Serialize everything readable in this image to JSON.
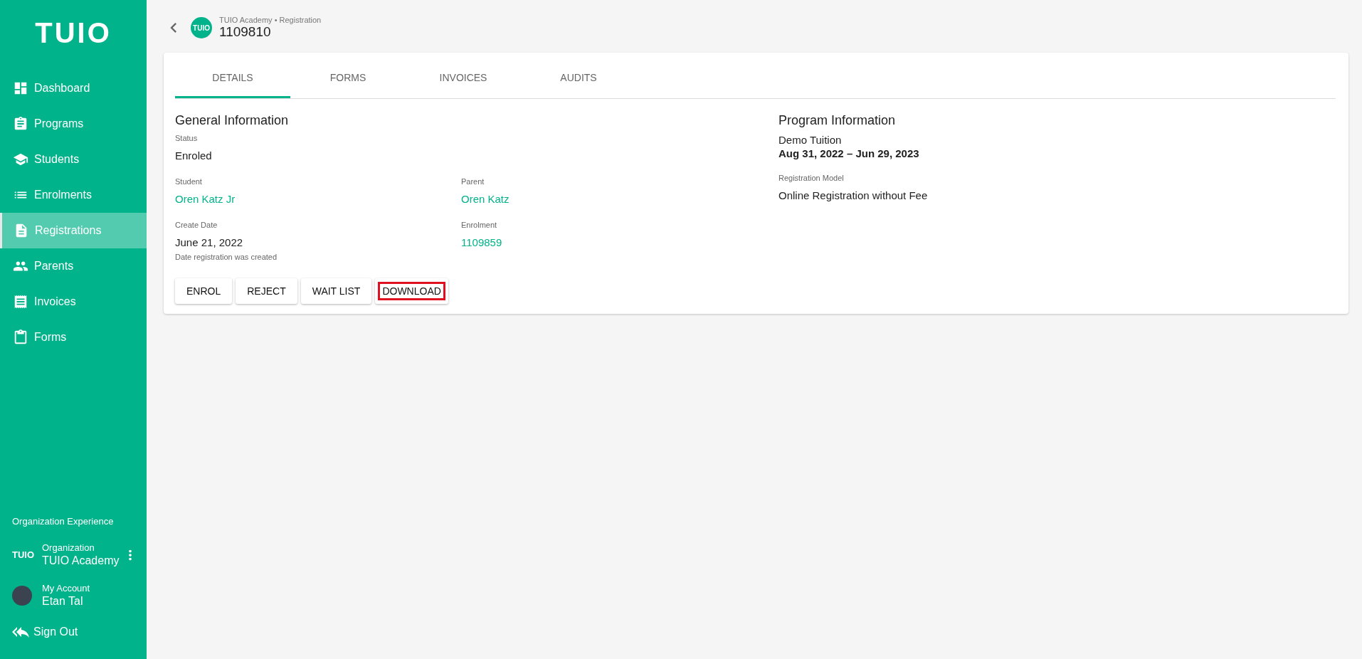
{
  "sidebar": {
    "logo": "TUIO",
    "items": [
      {
        "label": "Dashboard",
        "selected": false
      },
      {
        "label": "Programs",
        "selected": false
      },
      {
        "label": "Students",
        "selected": false
      },
      {
        "label": "Enrolments",
        "selected": false
      },
      {
        "label": "Registrations",
        "selected": true
      },
      {
        "label": "Parents",
        "selected": false
      },
      {
        "label": "Invoices",
        "selected": false
      },
      {
        "label": "Forms",
        "selected": false
      }
    ],
    "section_title": "Organization Experience",
    "organization": {
      "logo": "TUIO",
      "label": "Organization",
      "name": "TUIO Academy"
    },
    "account": {
      "label": "My Account",
      "name": "Etan Tal"
    },
    "sign_out": "Sign Out"
  },
  "header": {
    "badge": "TUIO",
    "breadcrumb": "TUIO Academy • Registration",
    "title": "1109810"
  },
  "tabs": [
    {
      "label": "DETAILS",
      "selected": true
    },
    {
      "label": "FORMS",
      "selected": false
    },
    {
      "label": "INVOICES",
      "selected": false
    },
    {
      "label": "AUDITS",
      "selected": false
    }
  ],
  "general": {
    "title": "General Information",
    "status": {
      "label": "Status",
      "value": "Enroled"
    },
    "student": {
      "label": "Student",
      "value": "Oren Katz Jr"
    },
    "parent": {
      "label": "Parent",
      "value": "Oren Katz"
    },
    "create_date": {
      "label": "Create Date",
      "value": "June 21, 2022",
      "hint": "Date registration was created"
    },
    "enrolment": {
      "label": "Enrolment",
      "value": "1109859"
    }
  },
  "buttons": [
    {
      "label": "ENROL",
      "highlighted": false
    },
    {
      "label": "REJECT",
      "highlighted": false
    },
    {
      "label": "WAIT LIST",
      "highlighted": false
    },
    {
      "label": "DOWNLOAD",
      "highlighted": true
    }
  ],
  "program": {
    "title": "Program Information",
    "name": "Demo Tuition",
    "dates": "Aug 31, 2022 – Jun 29, 2023",
    "model_label": "Registration Model",
    "model_value": "Online Registration without Fee"
  }
}
